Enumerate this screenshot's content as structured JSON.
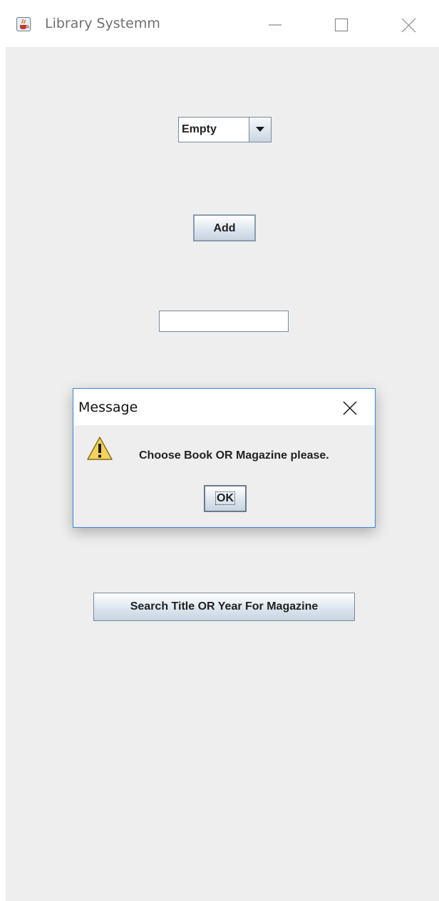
{
  "window": {
    "title": "Library Systemm",
    "icon": "java-cup-icon",
    "controls": [
      "minimize-icon",
      "maximize-icon",
      "close-icon"
    ]
  },
  "form": {
    "type_combo": {
      "selected": "Empty"
    },
    "add_label": "Add",
    "input_value": "",
    "search_label": "Search Title OR Year For Magazine"
  },
  "dialog": {
    "title": "Message",
    "icon": "warning-icon",
    "message": "Choose Book OR Magazine please.",
    "ok_label": "OK"
  },
  "colors": {
    "dialog_border": "#3c8ad6",
    "background": "#eeeeee",
    "warning_fill": "#f3d35a"
  }
}
